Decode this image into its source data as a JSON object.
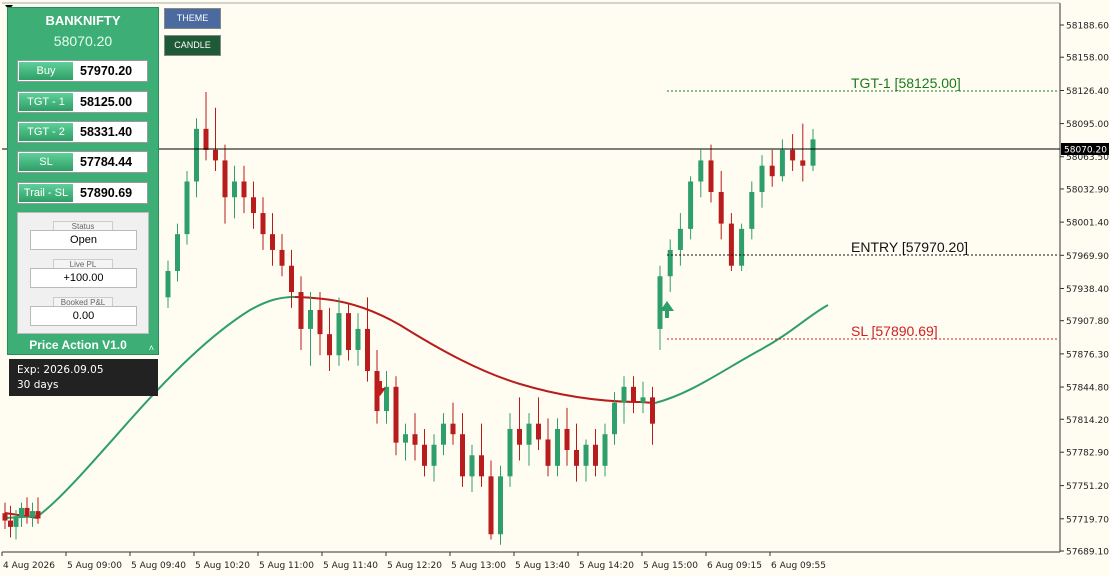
{
  "panel": {
    "symbol": "BANKNIFTY",
    "price": "58070.20",
    "rows": [
      {
        "label": "Buy",
        "value": "57970.20"
      },
      {
        "label": "TGT - 1",
        "value": "58125.00"
      },
      {
        "label": "TGT - 2",
        "value": "58331.40"
      },
      {
        "label": "SL",
        "value": "57784.44"
      },
      {
        "label": "Trail - SL",
        "value": "57890.69"
      }
    ],
    "status_label": "Status",
    "status_value": "Open",
    "livepl_label": "Live PL",
    "livepl_value": "+100.00",
    "booked_label": "Booked P&L",
    "booked_value": "0.00",
    "version": "Price Action V1.0",
    "collapse_glyph": "˄"
  },
  "expiry": {
    "line1": "Exp: 2026.09.05",
    "line2": "30 days"
  },
  "buttons": {
    "theme": "THEME",
    "candle": "CANDLE"
  },
  "levels": {
    "tgt1": "TGT-1 [58125.00]",
    "entry": "ENTRY [57970.20]",
    "sl": "SL [57890.69]"
  },
  "colors": {
    "background": "#fffdf2",
    "bull": "#2e9e6a",
    "bear": "#b81c1c",
    "tgt": "#1a7a1a",
    "sl": "#cc2222",
    "panel": "#3cae76"
  },
  "chart_data": {
    "type": "candlestick",
    "symbol": "BANKNIFTY",
    "current_price": 58070.2,
    "y_tick_labels": [
      "58188.60",
      "58158.00",
      "58126.40",
      "58095.00",
      "58063.50",
      "58032.90",
      "58001.40",
      "57969.90",
      "57938.40",
      "57907.80",
      "57876.30",
      "57844.80",
      "57814.20",
      "57782.90",
      "57751.20",
      "57719.70",
      "57689.10"
    ],
    "x_tick_labels": [
      "4 Aug 2026",
      "5 Aug 09:00",
      "5 Aug 09:40",
      "5 Aug 10:20",
      "5 Aug 11:00",
      "5 Aug 11:40",
      "5 Aug 12:20",
      "5 Aug 13:00",
      "5 Aug 13:40",
      "5 Aug 14:20",
      "5 Aug 15:00",
      "6 Aug 09:15",
      "6 Aug 09:55"
    ],
    "levels": {
      "tgt1": 58125.0,
      "entry": 57970.2,
      "sl": 57890.69
    },
    "candles_ohlc": [
      [
        57725,
        57735,
        57710,
        57718
      ],
      [
        57718,
        57732,
        57702,
        57712
      ],
      [
        57712,
        57728,
        57700,
        57722
      ],
      [
        57722,
        57735,
        57712,
        57730
      ],
      [
        57730,
        57740,
        57715,
        57722
      ],
      [
        57722,
        57735,
        57712,
        57727
      ],
      [
        57727,
        57740,
        57715,
        57720
      ],
      [
        57930,
        57965,
        57920,
        57955
      ],
      [
        57955,
        58000,
        57945,
        57990
      ],
      [
        57990,
        58050,
        57980,
        58040
      ],
      [
        58040,
        58100,
        58025,
        58090
      ],
      [
        58090,
        58125,
        58060,
        58070
      ],
      [
        58070,
        58110,
        58050,
        58060
      ],
      [
        58060,
        58075,
        58000,
        58025
      ],
      [
        58025,
        58055,
        58005,
        58040
      ],
      [
        58040,
        58055,
        58010,
        58025
      ],
      [
        58025,
        58040,
        57995,
        58010
      ],
      [
        58010,
        58025,
        57975,
        57990
      ],
      [
        57990,
        58010,
        57960,
        57975
      ],
      [
        57975,
        57990,
        57950,
        57960
      ],
      [
        57960,
        57975,
        57920,
        57935
      ],
      [
        57935,
        57950,
        57880,
        57900
      ],
      [
        57900,
        57935,
        57865,
        57918
      ],
      [
        57918,
        57935,
        57875,
        57895
      ],
      [
        57895,
        57920,
        57860,
        57875
      ],
      [
        57875,
        57930,
        57865,
        57915
      ],
      [
        57915,
        57925,
        57870,
        57880
      ],
      [
        57880,
        57915,
        57865,
        57900
      ],
      [
        57900,
        57930,
        57850,
        57860
      ],
      [
        57860,
        57880,
        57810,
        57822
      ],
      [
        57822,
        57860,
        57810,
        57845
      ],
      [
        57845,
        57855,
        57780,
        57792
      ],
      [
        57792,
        57810,
        57775,
        57800
      ],
      [
        57800,
        57820,
        57775,
        57790
      ],
      [
        57790,
        57805,
        57760,
        57770
      ],
      [
        57770,
        57800,
        57755,
        57790
      ],
      [
        57790,
        57820,
        57780,
        57810
      ],
      [
        57810,
        57830,
        57790,
        57800
      ],
      [
        57800,
        57820,
        57750,
        57760
      ],
      [
        57760,
        57790,
        57745,
        57780
      ],
      [
        57780,
        57810,
        57750,
        57760
      ],
      [
        57760,
        57775,
        57700,
        57705
      ],
      [
        57705,
        57770,
        57695,
        57760
      ],
      [
        57760,
        57820,
        57750,
        57805
      ],
      [
        57805,
        57835,
        57775,
        57790
      ],
      [
        57790,
        57820,
        57770,
        57810
      ],
      [
        57810,
        57835,
        57785,
        57795
      ],
      [
        57795,
        57815,
        57760,
        57770
      ],
      [
        57770,
        57815,
        57760,
        57805
      ],
      [
        57805,
        57825,
        57770,
        57785
      ],
      [
        57785,
        57810,
        57755,
        57770
      ],
      [
        57770,
        57795,
        57755,
        57790
      ],
      [
        57790,
        57805,
        57760,
        57770
      ],
      [
        57770,
        57810,
        57760,
        57800
      ],
      [
        57800,
        57840,
        57790,
        57830
      ],
      [
        57830,
        57855,
        57810,
        57845
      ],
      [
        57845,
        57855,
        57820,
        57830
      ],
      [
        57830,
        57850,
        57820,
        57835
      ],
      [
        57835,
        57845,
        57790,
        57810
      ],
      [
        57900,
        57960,
        57880,
        57950
      ],
      [
        57950,
        57985,
        57935,
        57975
      ],
      [
        57975,
        58010,
        57960,
        57995
      ],
      [
        57995,
        58045,
        57985,
        58040
      ],
      [
        58040,
        58070,
        58025,
        58060
      ],
      [
        58060,
        58075,
        58020,
        58030
      ],
      [
        58030,
        58050,
        57985,
        58000
      ],
      [
        58000,
        58010,
        57955,
        57960
      ],
      [
        57960,
        58000,
        57955,
        57995
      ],
      [
        57995,
        58040,
        57985,
        58030
      ],
      [
        58030,
        58065,
        58015,
        58055
      ],
      [
        58055,
        58070,
        58035,
        58045
      ],
      [
        58045,
        58080,
        58040,
        58070
      ],
      [
        58070,
        58085,
        58050,
        58060
      ],
      [
        58060,
        58095,
        58040,
        58055
      ],
      [
        58055,
        58090,
        58050,
        58080
      ]
    ],
    "ma_line": "green then red moving average"
  }
}
